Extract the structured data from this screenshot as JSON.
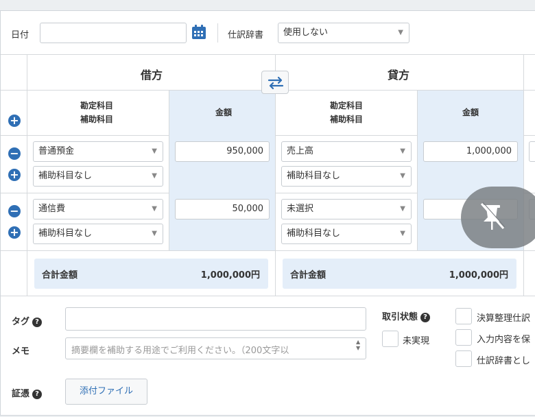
{
  "header": {
    "date_label": "日付",
    "dict_label": "仕訳辞書",
    "dict_value": "使用しない"
  },
  "debit": {
    "title": "借方",
    "account_header_1": "勘定科目",
    "account_header_2": "補助科目",
    "amount_header": "金額"
  },
  "credit": {
    "title": "貸方",
    "account_header_1": "勘定科目",
    "account_header_2": "補助科目",
    "amount_header": "金額"
  },
  "rows": [
    {
      "debit_account": "普通預金",
      "debit_sub": "補助科目なし",
      "debit_amount": "950,000",
      "credit_account": "売上高",
      "credit_sub": "補助科目なし",
      "credit_amount": "1,000,000"
    },
    {
      "debit_account": "通信費",
      "debit_sub": "補助科目なし",
      "debit_amount": "50,000",
      "credit_account": "未選択",
      "credit_sub": "補助科目なし",
      "credit_amount": ""
    }
  ],
  "totals": {
    "label": "合計金額",
    "debit_total": "1,000,000円",
    "credit_total": "1,000,000円"
  },
  "bottom": {
    "tag_label": "タグ",
    "memo_label": "メモ",
    "memo_placeholder": "摘要欄を補助する用途でご利用ください。（200文字以",
    "evidence_label": "証憑",
    "attach_label": "添付ファイル",
    "status_label": "取引状態",
    "unrealized_label": "未実現",
    "closing_label": "決算整理仕訳",
    "keep_input_label": "入力内容を保",
    "save_dict_label": "仕訳辞書とし"
  },
  "icons": {
    "calendar": "calendar-icon",
    "swap": "swap-arrows-icon",
    "pin": "unpin-icon"
  },
  "colors": {
    "accent": "#2f6fb5",
    "amount_column": "#e4eef9"
  }
}
